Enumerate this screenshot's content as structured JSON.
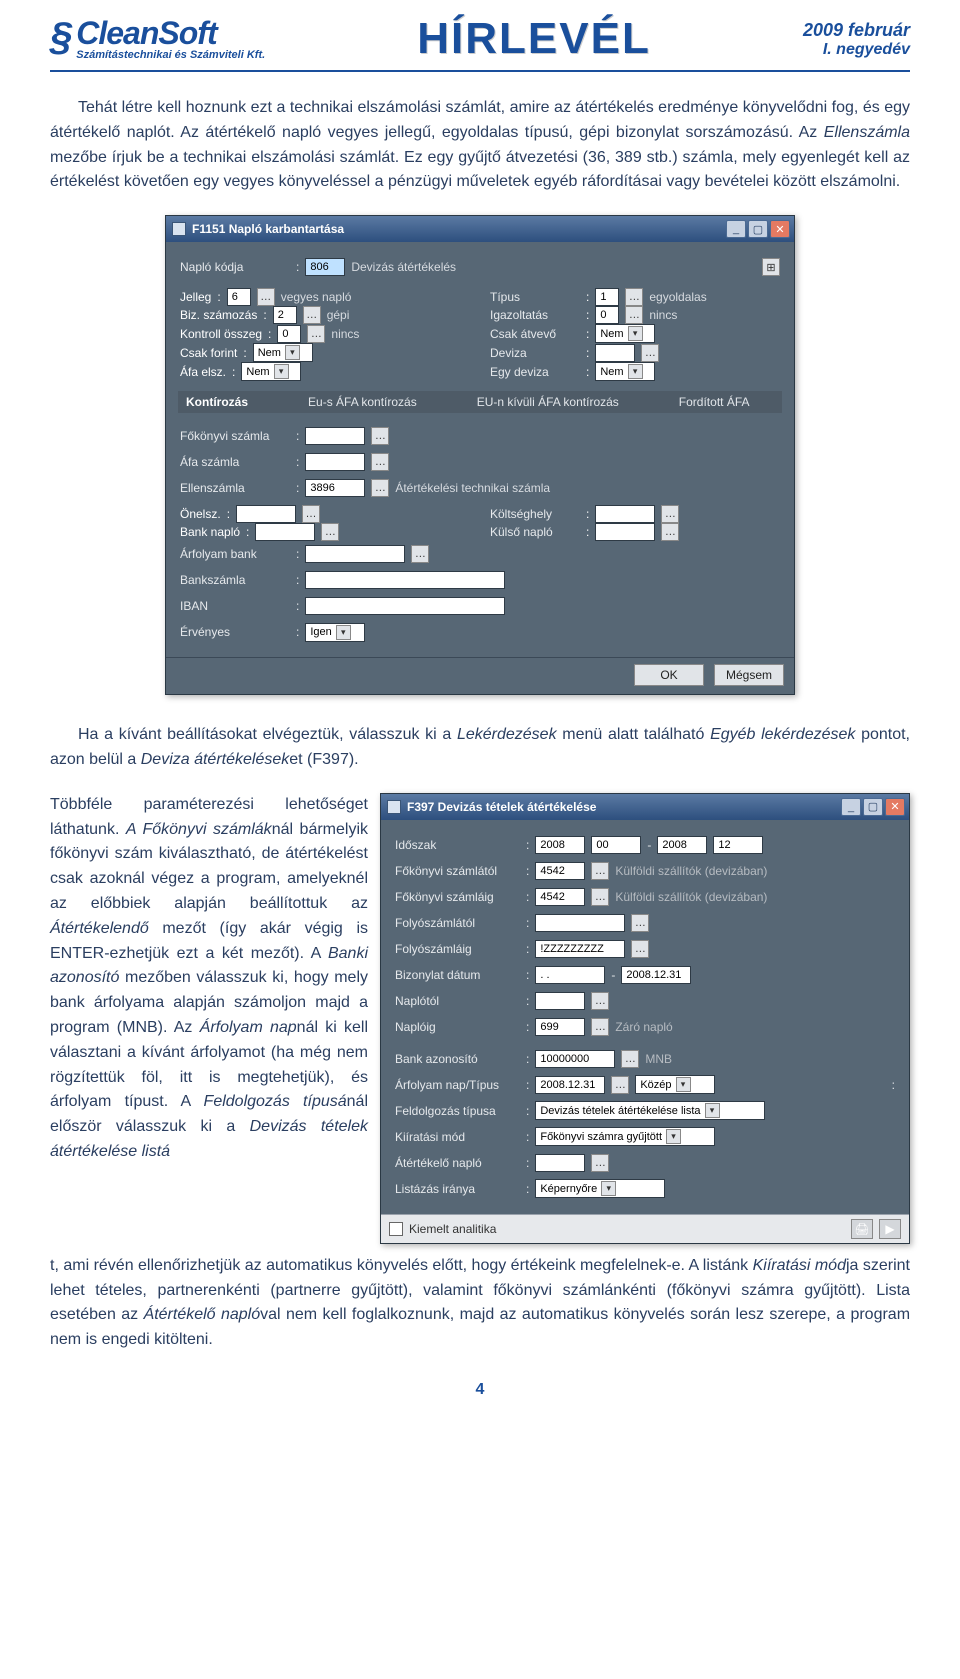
{
  "header": {
    "logo_name": "CleanSoft",
    "logo_sub": "Számítástechnikai és Számviteli Kft.",
    "center_title": "HÍRLEVÉL",
    "date_line1": "2009 február",
    "date_line2": "I. negyedév"
  },
  "para1_run1": "Tehát létre kell hoznunk ezt a technikai elszámolási számlát, amire az átértékelés eredménye könyvelődni fog, és egy átértékelő naplót. Az átértékelő napló vegyes jellegű, egyoldalas típusú, gépi bizonylat sorszámozású. Az ",
  "para1_em1": "Ellenszámla",
  "para1_run2": " mezőbe írjuk be a technikai elszámolási számlát. Ez egy gyűjtő átvezetési (36, 389 stb.) számla, mely egyenlegét kell az értékelést követően egy vegyes könyveléssel a pénzügyi műveletek egyéb ráfordításai vagy bevételei között elszámolni.",
  "dialog1": {
    "title": "F1151 Napló karbantartása",
    "naplo_kodja_label": "Napló kódja",
    "naplo_kodja_value": "806",
    "naplo_kodja_desc": "Devizás átértékelés",
    "jelleg_label": "Jelleg",
    "jelleg_value": "6",
    "jelleg_desc": "vegyes napló",
    "tipus_label": "Típus",
    "tipus_value": "1",
    "tipus_desc": "egyoldalas",
    "bizszam_label": "Biz. számozás",
    "bizszam_value": "2",
    "bizszam_desc": "gépi",
    "igazoltatas_label": "Igazoltatás",
    "igazoltatas_value": "0",
    "igazoltatas_desc": "nincs",
    "kontroll_label": "Kontroll összeg",
    "kontroll_value": "0",
    "kontroll_desc": "nincs",
    "csakatvevo_label": "Csak átvevő",
    "csakatvevo_value": "Nem",
    "csakforint_label": "Csak forint",
    "csakforint_value": "Nem",
    "deviza_label": "Deviza",
    "deviza_value": "",
    "afaelsz_label": "Áfa elsz.",
    "afaelsz_value": "Nem",
    "egydeviza_label": "Egy deviza",
    "egydeviza_value": "Nem",
    "tab_kontir": "Kontírozás",
    "tab_eusafa": "Eu-s ÁFA kontírozás",
    "tab_eunkivuli": "EU-n kívüli ÁFA kontírozás",
    "tab_forditott": "Fordított ÁFA",
    "fokonyvi_label": "Főkönyvi számla",
    "afa_szamla_label": "Áfa számla",
    "ellenszamla_label": "Ellenszámla",
    "ellenszamla_value": "3896",
    "ellenszamla_desc": "Átértékelési technikai számla",
    "onelsz_label": "Önelsz.",
    "koltseghely_label": "Költséghely",
    "banknaplo_label": "Bank napló",
    "kulsonaplo_label": "Külső napló",
    "arfolyambank_label": "Árfolyam bank",
    "bankszamla_label": "Bankszámla",
    "iban_label": "IBAN",
    "ervenyes_label": "Érvényes",
    "ervenyes_value": "Igen",
    "btn_ok": "OK",
    "btn_cancel": "Mégsem"
  },
  "para2_run1": "Ha a kívánt beállításokat elvégeztük, válasszuk ki a ",
  "para2_em1": "Lekérdezések",
  "para2_run2": " menü alatt található ",
  "para2_em2": "Egyéb lekérdezések",
  "para2_run3": " pontot, azon belül a ",
  "para2_em3": "Deviza átértékelések",
  "para2_run4": "et (F397).",
  "para3_run1": "Többféle paraméterezési lehetőséget láthatunk. ",
  "para3_em1": "A Főkönyvi számlák",
  "para3_run2": "nál bármelyik főkönyvi szám kiválasztható, de átértékelést csak azoknál végez a program, amelyeknél az előbbiek alapján beállítottuk az ",
  "para3_em2": "Átértékelendő",
  "para3_run3": " mezőt (így akár végig is ENTER-ezhetjük ezt a két mezőt). A ",
  "para3_em3": "Banki azonosító",
  "para3_run4": " mezőben válasszuk ki, hogy mely bank árfolyama alapján számoljon majd a program (MNB). Az ",
  "para3_em4": "Árfolyam nap",
  "para3_run5": "nál ki kell választani a kívánt árfolyamot (ha még nem rögzítettük föl, itt is megtehetjük), és árfolyam típust. A ",
  "para3_em5": "Feldolgozás típusá",
  "para3_run6": "nál először válasszuk ki a ",
  "para3_em6": "Devizás tételek átértékelése listá",
  "para3_run7": "t, ami révén ellenőrizhetjük az automatikus könyvelés előtt, hogy értékeink megfelelnek-e. A listánk ",
  "para3_em7": "Kiíratási mód",
  "para3_run8": "ja szerint lehet tételes, partnerenkénti (partnerre gyűjtött), valamint főkönyvi számlánkénti (főkönyvi számra gyűjtött). Lista esetében az ",
  "para3_em8": "Átértékelő napló",
  "para3_run9": "val nem kell foglalkoznunk, majd az automatikus könyvelés során lesz szerepe, a program nem is engedi kitölteni.",
  "dialog2": {
    "title": "F397 Devizás tételek átértékelése",
    "idoszak_label": "Időszak",
    "idoszak_y1": "2008",
    "idoszak_m1": "00",
    "idoszak_y2": "2008",
    "idoszak_m2": "12",
    "fksz_from_label": "Főkönyvi számlától",
    "fksz_from_value": "4542",
    "fksz_desc": "Külföldi szállítók (devizában)",
    "fksz_to_label": "Főkönyvi számláig",
    "fksz_to_value": "4542",
    "folyo_from_label": "Folyószámlától",
    "folyo_to_label": "Folyószámláig",
    "folyo_to_value": "!ZZZZZZZZZ",
    "bizdatum_label": "Bizonylat dátum",
    "bizdatum_from": ". .",
    "bizdatum_to": "2008.12.31",
    "naplotol_label": "Naplótól",
    "naploig_label": "Naplóig",
    "naploig_value": "699",
    "naploig_desc": "Záró napló",
    "bankaz_label": "Bank azonosító",
    "bankaz_value": "10000000",
    "bankaz_desc": "MNB",
    "arfolynap_label": "Árfolyam nap/Típus",
    "arfolynap_value": "2008.12.31",
    "arfolynap_tipus": "Közép",
    "feldolg_label": "Feldolgozás típusa",
    "feldolg_value": "Devizás tételek átértékelése lista",
    "kiir_label": "Kiíratási mód",
    "kiir_value": "Főkönyvi számra gyűjtött",
    "atert_label": "Átértékelő napló",
    "list_label": "Listázás iránya",
    "list_value": "Képernyőre",
    "kiemelt_label": "Kiemelt analitika"
  },
  "page_num": "4"
}
